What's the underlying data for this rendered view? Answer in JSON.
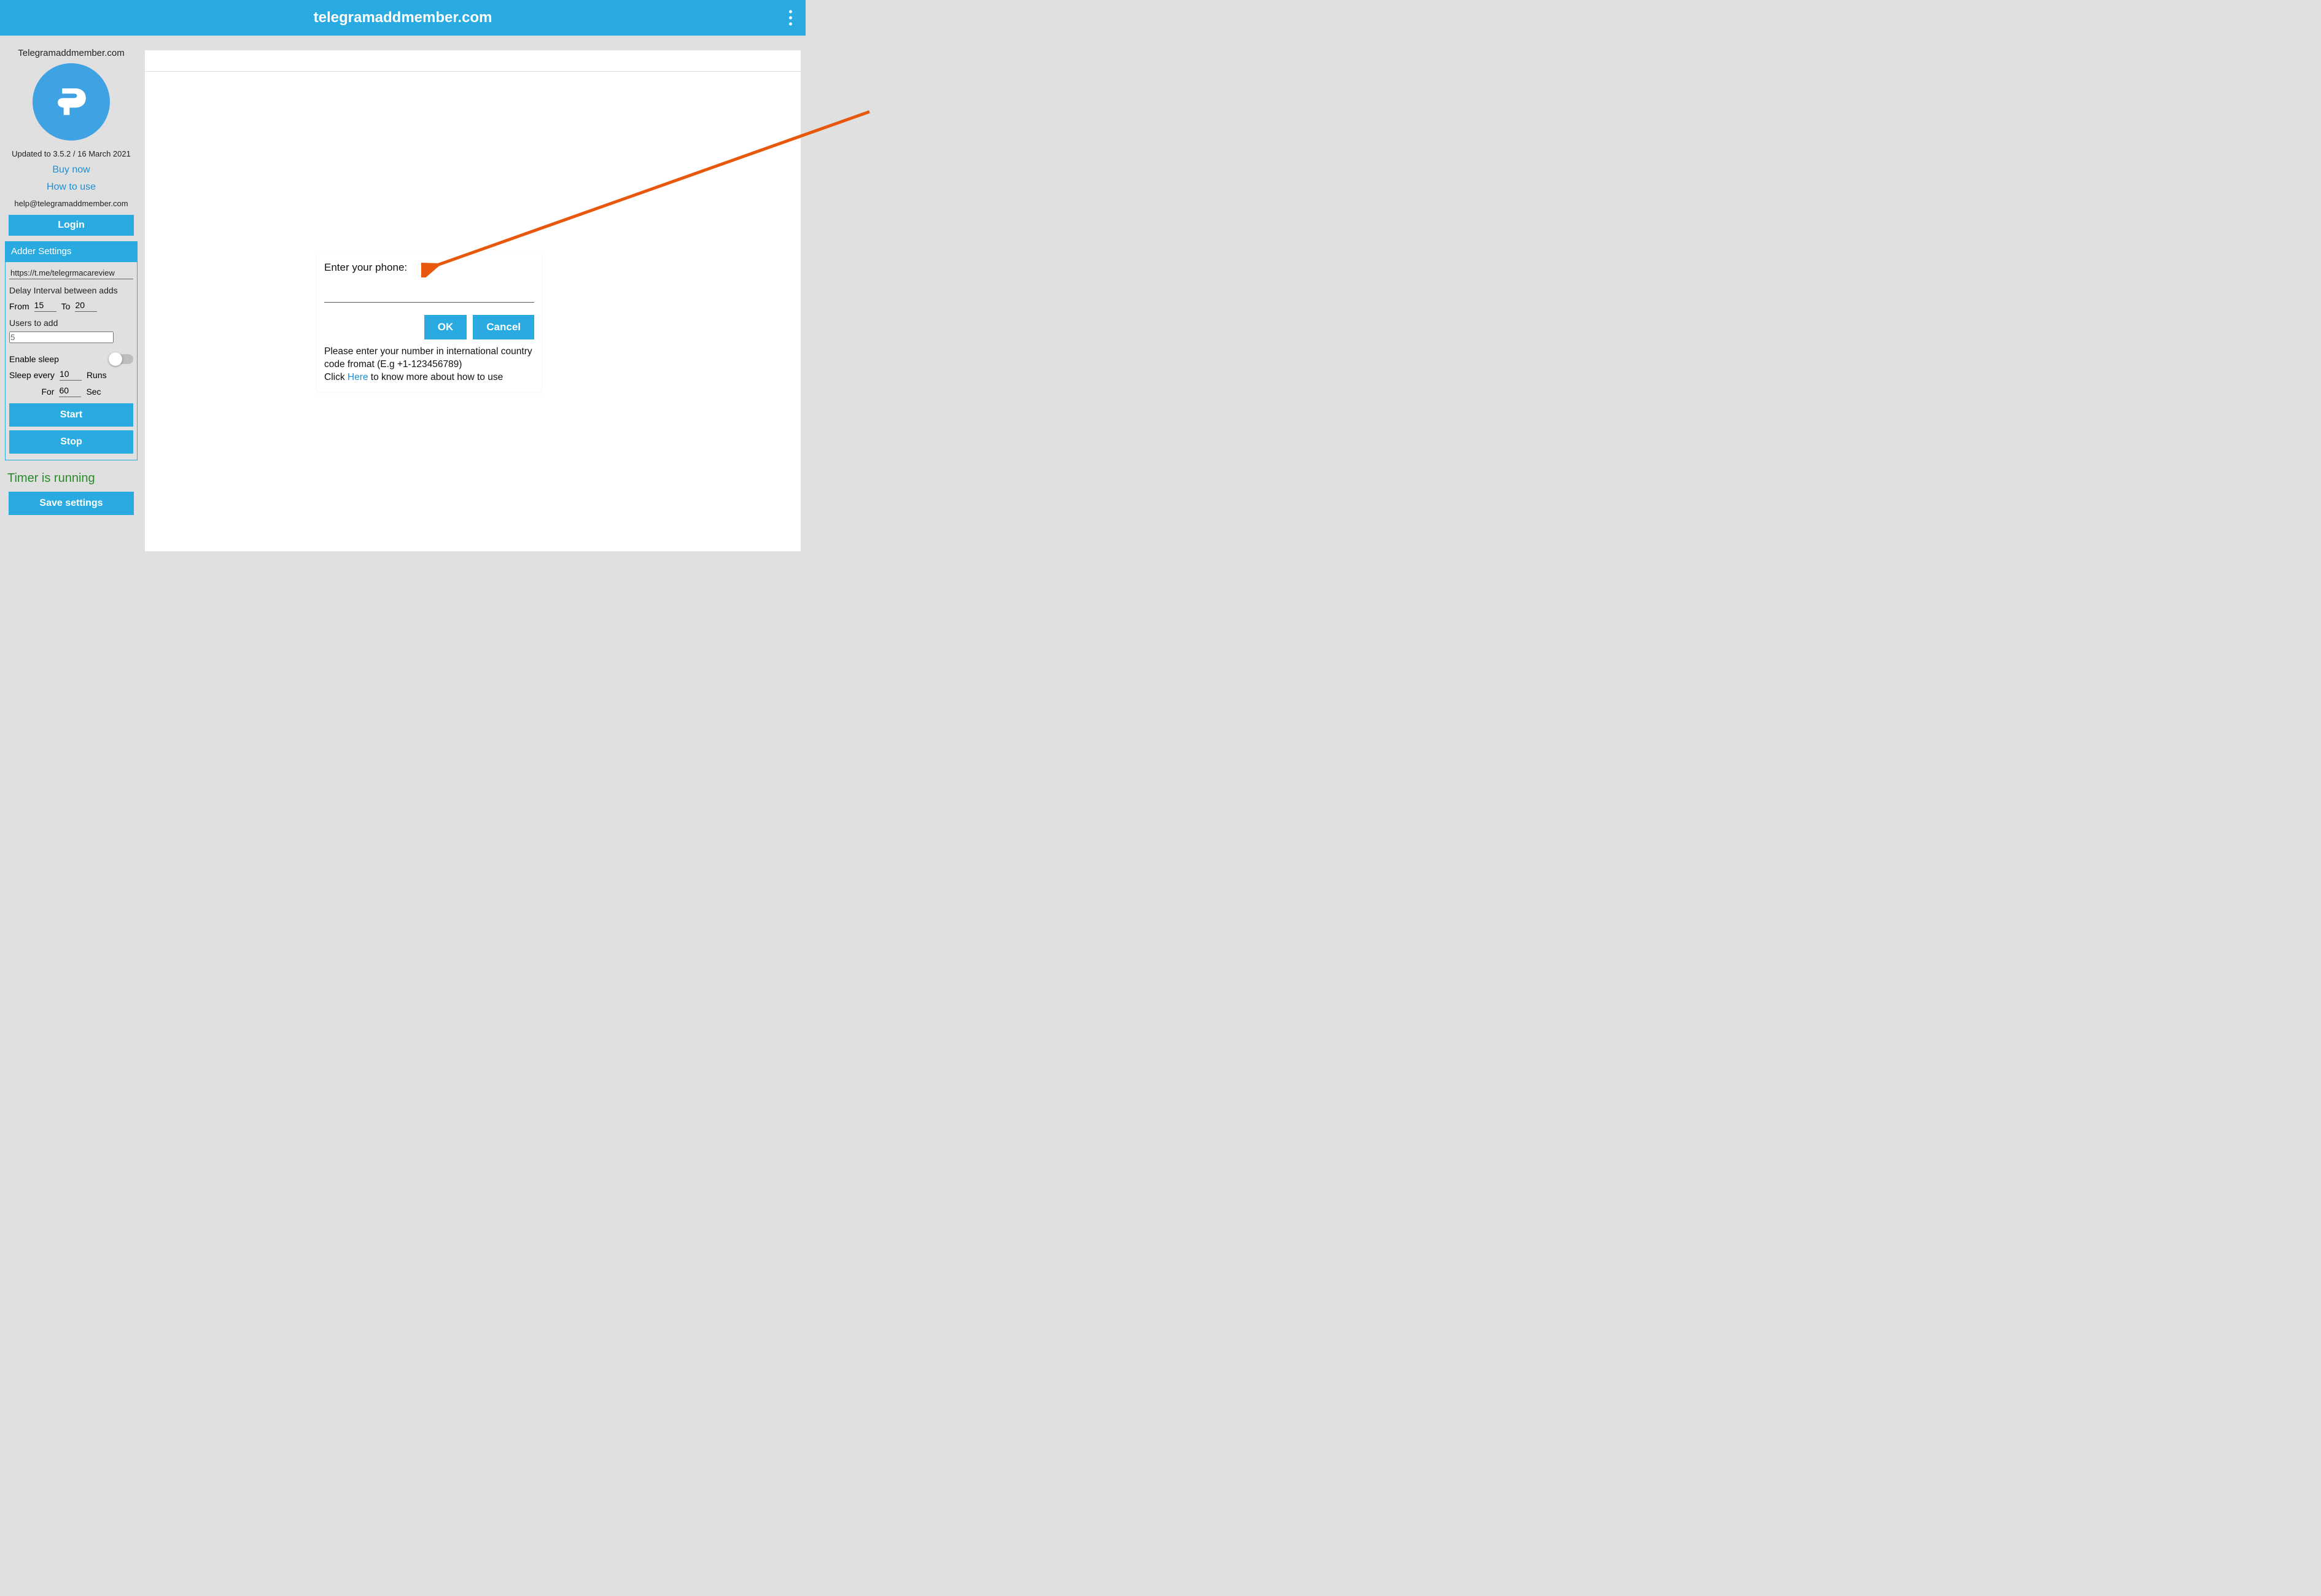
{
  "titlebar": {
    "title": "telegramaddmember.com"
  },
  "sidebar": {
    "brand": "Telegramaddmember.com",
    "update_text": "Updated to 3.5.2 / 16 March 2021",
    "buy_now": "Buy now",
    "how_to_use": "How to use",
    "email": "help@telegramaddmember.com",
    "login_btn": "Login",
    "section_header": "Adder Settings",
    "url_value": "https://t.me/telegrmacareview",
    "delay_label": "Delay Interval between adds",
    "from_label": "From",
    "from_value": "15",
    "to_label": "To",
    "to_value": "20",
    "users_label": "Users to add",
    "users_value": "5",
    "enable_sleep_label": "Enable sleep",
    "sleep_every_label": "Sleep every",
    "sleep_every_value": "10",
    "runs_label": "Runs",
    "for_label": "For",
    "for_value": "60",
    "sec_label": "Sec",
    "start_btn": "Start",
    "stop_btn": "Stop",
    "timer_text": "Timer is running",
    "save_btn": "Save settings"
  },
  "dialog": {
    "label": "Enter your phone:",
    "ok": "OK",
    "cancel": "Cancel",
    "help_line1": "Please enter your number in international country code fromat (E.g +1-123456789)",
    "help_click": "Click ",
    "help_here": "Here",
    "help_rest": " to know more about how to use"
  }
}
